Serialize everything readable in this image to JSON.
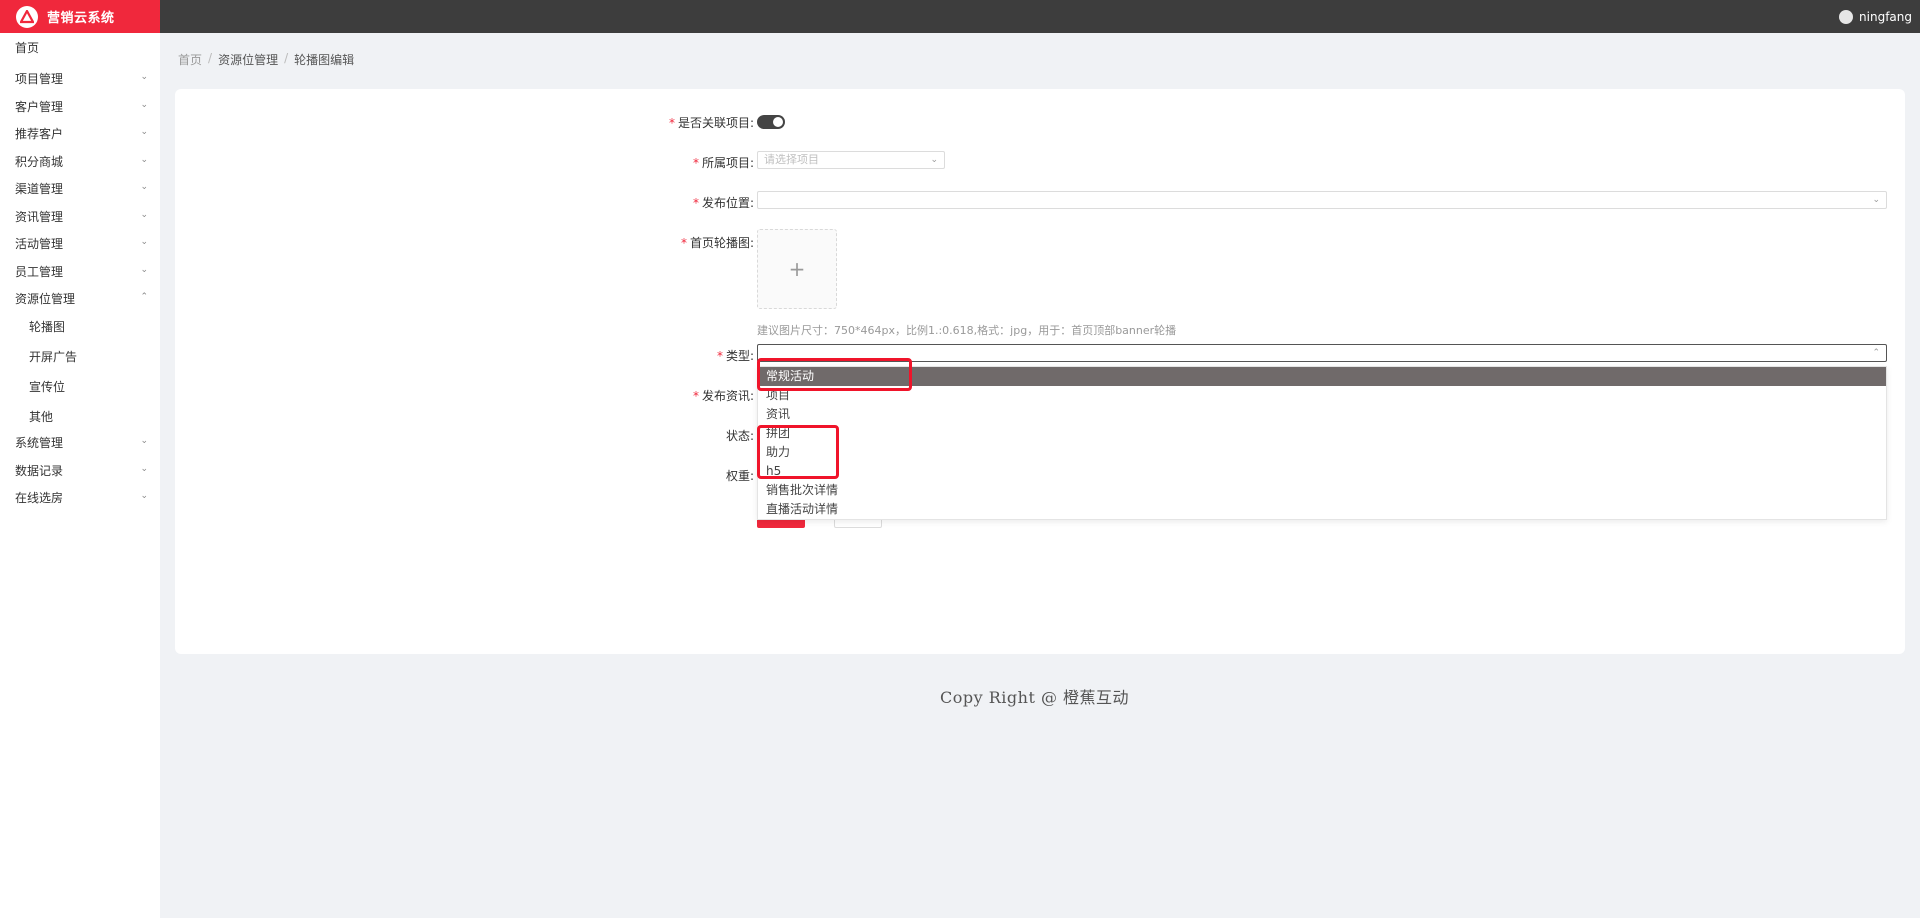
{
  "app": {
    "title": "营销云系统"
  },
  "header": {
    "username": "ningfang"
  },
  "sidebar": {
    "items": [
      {
        "label": "首页"
      },
      {
        "label": "项目管理"
      },
      {
        "label": "客户管理"
      },
      {
        "label": "推荐客户"
      },
      {
        "label": "积分商城"
      },
      {
        "label": "渠道管理"
      },
      {
        "label": "资讯管理"
      },
      {
        "label": "活动管理"
      },
      {
        "label": "员工管理"
      },
      {
        "label": "资源位管理"
      },
      {
        "label": "系统管理"
      },
      {
        "label": "数据记录"
      },
      {
        "label": "在线选房"
      }
    ],
    "subitems": [
      {
        "label": "轮播图"
      },
      {
        "label": "开屏广告"
      },
      {
        "label": "宣传位"
      },
      {
        "label": "其他"
      }
    ]
  },
  "breadcrumb": {
    "home": "首页",
    "section": "资源位管理",
    "current": "轮播图编辑",
    "sep": "/"
  },
  "form": {
    "link_project_label": "是否关联项目:",
    "project_label": "所属项目:",
    "project_placeholder": "请选择项目",
    "position_label": "发布位置:",
    "banner_label": "首页轮播图:",
    "upload_plus": "+",
    "hint": "建议图片尺寸：750*464px，比例1.:0.618,格式：jpg，用于：首页顶部banner轮播",
    "type_label": "类型:",
    "news_label": "发布资讯:",
    "status_label": "状态:",
    "weight_label": "权重:",
    "required_mark": "*"
  },
  "dropdown": {
    "options": [
      {
        "label": "常规活动",
        "selected": true
      },
      {
        "label": "项目"
      },
      {
        "label": "资讯"
      },
      {
        "label": "拼团"
      },
      {
        "label": "助力"
      },
      {
        "label": "h5"
      },
      {
        "label": "销售批次详情"
      },
      {
        "label": "直播活动详情"
      }
    ]
  },
  "footer": {
    "text": "Copy Right @ 橙蕉互动"
  },
  "colors": {
    "brand": "#f0283c",
    "header": "#3d3d3d",
    "annotation": "#f0142a"
  }
}
